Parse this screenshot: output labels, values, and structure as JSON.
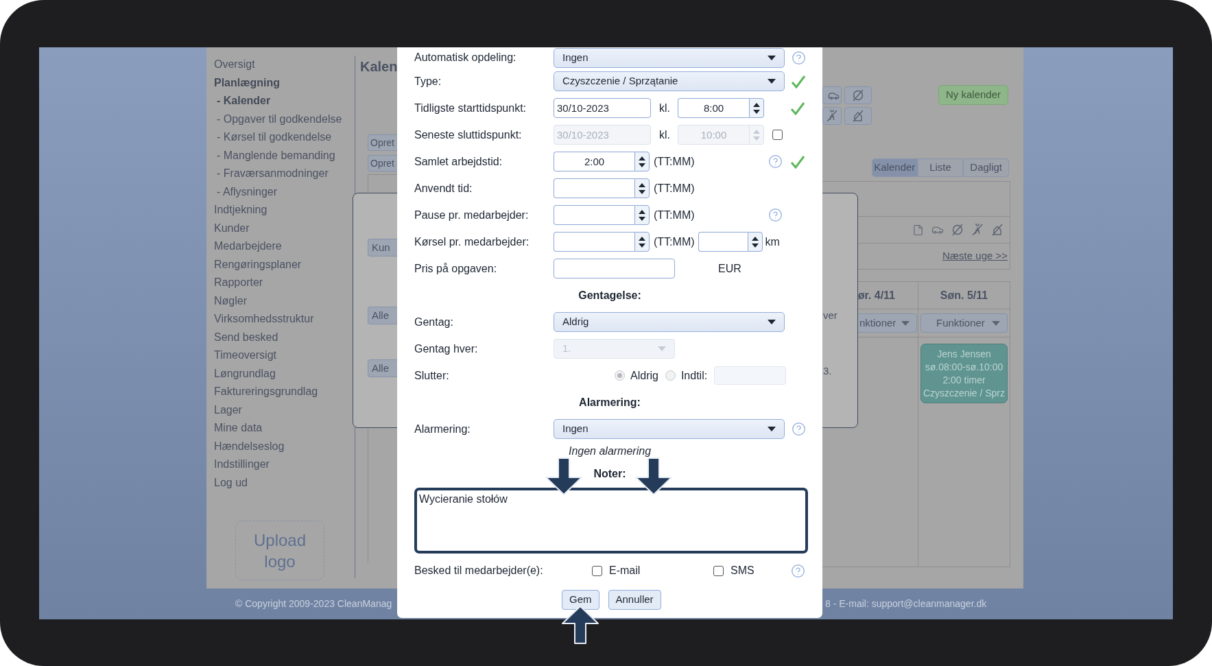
{
  "page": {
    "title": "Kalen",
    "sidebar": {
      "items": [
        {
          "label": "Oversigt",
          "selected": false
        },
        {
          "label": "Planlægning",
          "selected": true,
          "children": [
            {
              "label": "- Kalender",
              "selected": true
            },
            {
              "label": "- Opgaver til godkendelse",
              "selected": false
            },
            {
              "label": "- Kørsel til godkendelse",
              "selected": false
            },
            {
              "label": "- Manglende bemanding",
              "selected": false
            },
            {
              "label": "- Fraværsanmodninger",
              "selected": false
            },
            {
              "label": "- Aflysninger",
              "selected": false
            }
          ]
        },
        {
          "label": "Indtjekning",
          "selected": false
        },
        {
          "label": "Kunder",
          "selected": false
        },
        {
          "label": "Medarbejdere",
          "selected": false
        },
        {
          "label": "Rengøringsplaner",
          "selected": false
        },
        {
          "label": "Rapporter",
          "selected": false
        },
        {
          "label": "Nøgler",
          "selected": false
        },
        {
          "label": "Virksomhedsstruktur",
          "selected": false
        },
        {
          "label": "Send besked",
          "selected": false
        },
        {
          "label": "Timeoversigt",
          "selected": false
        },
        {
          "label": "Løngrundlag",
          "selected": false
        },
        {
          "label": "Faktureringsgrundlag",
          "selected": false
        },
        {
          "label": "Lager",
          "selected": false
        },
        {
          "label": "Mine data",
          "selected": false
        },
        {
          "label": "Hændelseslog",
          "selected": false
        },
        {
          "label": "Indstillinger",
          "selected": false
        },
        {
          "label": "Log ud",
          "selected": false
        }
      ]
    },
    "upload_logo": "Upload logo",
    "left_buttons": [
      "Opret",
      "Opret"
    ],
    "new_calendar_button": "Ny kalender",
    "view_tabs": [
      {
        "label": "Kalender",
        "selected": true
      },
      {
        "label": "Liste",
        "selected": false
      },
      {
        "label": "Dagligt",
        "selected": false
      }
    ],
    "next_week_link": "Næste uge >>",
    "days": [
      {
        "header": "ør. 4/11",
        "menu": "nktioner"
      },
      {
        "header": "Søn. 5/11",
        "menu": "Funktioner",
        "events": [
          {
            "lines": [
              "Jens Jensen",
              "sø.08:00-sø.10:00",
              "2:00 timer",
              "Czyszczenie / Sprz"
            ]
          }
        ]
      }
    ],
    "footer_left": "© Copyright 2009-2023 CleanManag",
    "footer_right": "8 - E-mail: support@cleanmanager.dk"
  },
  "back_dialog": {
    "buttons": [
      "Kun",
      "Alle",
      "Alle"
    ],
    "texts": [
      "ver",
      "3."
    ]
  },
  "dialog": {
    "rows": [
      {
        "kind": "select",
        "label": "Automatisk opdeling:",
        "value": "Ingen",
        "help": true,
        "valid": false
      },
      {
        "kind": "select",
        "label": "Type:",
        "value": "Czyszczenie / Sprzątanie",
        "help": false,
        "valid": true
      },
      {
        "kind": "datetime",
        "label": "Tidligste starttidspunkt:",
        "date": "30/10-2023",
        "kl": "kl.",
        "time": "8:00",
        "disabled": false,
        "valid": true
      },
      {
        "kind": "datetime",
        "label": "Seneste sluttidspunkt:",
        "date": "30/10-2023",
        "kl": "kl.",
        "time": "10:00",
        "disabled": true,
        "checked": false,
        "valid": false
      },
      {
        "kind": "spinner",
        "label": "Samlet arbejdstid:",
        "value": "2:00",
        "unit": "(TT:MM)",
        "help": true,
        "valid": true
      },
      {
        "kind": "spinner",
        "label": "Anvendt tid:",
        "unit": "(TT:MM)",
        "help": false,
        "valid": false
      },
      {
        "kind": "spinner",
        "label": "Pause pr. medarbejder:",
        "unit": "(TT:MM)",
        "help": true,
        "valid": false
      },
      {
        "kind": "spinner",
        "label": "Kørsel pr. medarbejder:",
        "unit": "(TT:MM)",
        "extra_unit": "km",
        "help": false,
        "valid": false
      },
      {
        "kind": "price",
        "label": "Pris på opgaven:",
        "currency": "EUR"
      },
      {
        "kind": "heading",
        "text": "Gentagelse:"
      },
      {
        "kind": "select",
        "label": "Gentag:",
        "value": "Aldrig",
        "help": false,
        "valid": false
      },
      {
        "kind": "small_select",
        "label": "Gentag hver:",
        "value": "1.",
        "disabled": true
      },
      {
        "kind": "radios",
        "label": "Slutter:",
        "options": [
          {
            "label": "Aldrig",
            "selected": true
          },
          {
            "label": "Indtil:",
            "selected": false
          }
        ]
      },
      {
        "kind": "heading",
        "text": "Alarmering:"
      },
      {
        "kind": "select",
        "label": "Alarmering:",
        "value": "Ingen",
        "help": true,
        "valid": false
      },
      {
        "kind": "note",
        "text": "Ingen alarmering"
      },
      {
        "kind": "heading",
        "text": "Noter:"
      },
      {
        "kind": "textarea",
        "value": "Wycieranie stołów"
      },
      {
        "kind": "checkboxes",
        "label": "Besked til medarbejder(e):",
        "options": [
          {
            "label": "E-mail",
            "checked": false
          },
          {
            "label": "SMS",
            "checked": false
          }
        ],
        "help": true
      }
    ],
    "buttons": [
      "Gem",
      "Annuller"
    ]
  }
}
